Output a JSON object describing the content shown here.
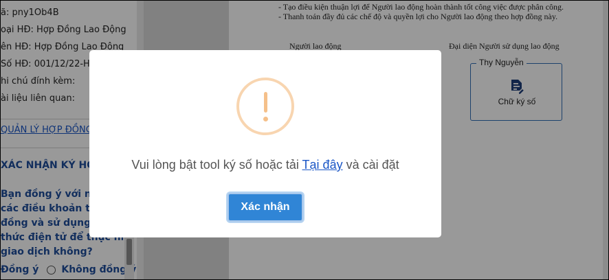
{
  "contract_info": {
    "code_line": "ã: pny1Ob4B",
    "type_line": "oại HĐ: Hợp Đồng Lao Động",
    "name_line": "ên HĐ: Hợp Đồng Lao Động",
    "number_line": "Số HĐ: 001/12/22-HĐLĐ",
    "note_line": "hi chú đính kèm:",
    "related_line": "ài liệu liên quan:"
  },
  "manage_link": "QUẢN LÝ HỢP ĐỒNG",
  "sign_heading": "XÁC NHẬN KÝ HỢP ĐỒNG",
  "question_lines": [
    "Bạn đồng ý với nội dung",
    "các điều khoản trong hợp",
    "đồng và sử dụng phương",
    "thức điện tử để thực hiện",
    "giao dịch không?"
  ],
  "radio": {
    "agree_label": "Đồng ý",
    "disagree_label": "Không đồng ý"
  },
  "document": {
    "line1": "- Tạo điều kiện thuận lợi để Người lao động hoàn thành tốt công việc được phân công.",
    "line2": "- Thanh toán đầy đủ các chế độ và quyền lợi cho Người lao động theo hợp đồng này.",
    "employee_label": "Người lao động",
    "employer_label": "Đại diện Người sử dụng lao động",
    "signer_name": "Thy Nguyễn",
    "digital_sign_label": "Chữ ký số",
    "sign_icon": "document-sign-icon"
  },
  "modal": {
    "message_before": "Vui lòng bật tool ký số hoặc tải ",
    "link_text": "Tại đây",
    "message_after": " và cài đặt",
    "confirm_label": "Xác nhận",
    "icon": "warning-icon"
  },
  "colors": {
    "primary": "#3085d6",
    "link": "#1a56c6",
    "heading": "#1f4e9c",
    "warning": "#f5c08a"
  }
}
